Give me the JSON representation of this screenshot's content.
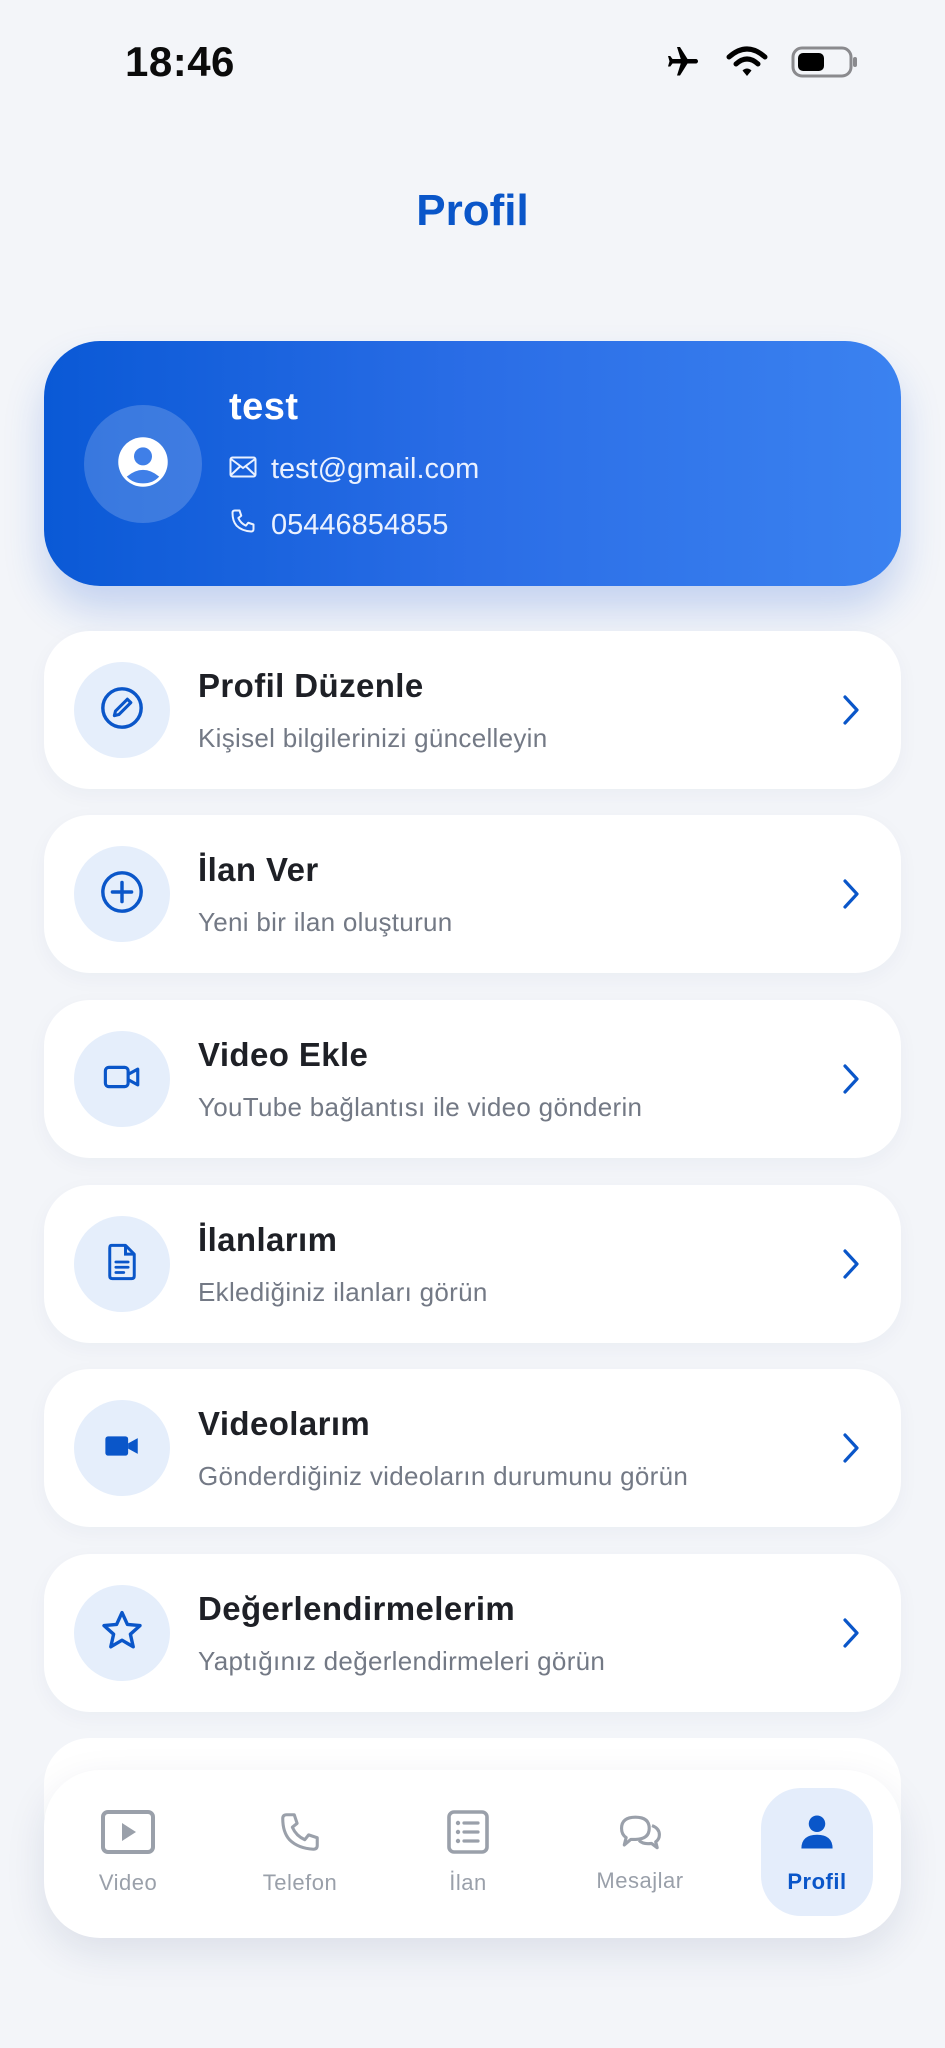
{
  "status_bar": {
    "time": "18:46"
  },
  "header": {
    "title": "Profil"
  },
  "profile": {
    "name": "test",
    "email": "test@gmail.com",
    "phone": "05446854855"
  },
  "menu": [
    {
      "title": "Profil Düzenle",
      "subtitle": "Kişisel bilgilerinizi güncelleyin",
      "icon": "edit-pencil-icon"
    },
    {
      "title": "İlan Ver",
      "subtitle": "Yeni bir ilan oluşturun",
      "icon": "plus-circle-icon"
    },
    {
      "title": "Video Ekle",
      "subtitle": "YouTube bağlantısı ile video gönderin",
      "icon": "video-camera-icon"
    },
    {
      "title": "İlanlarım",
      "subtitle": "Eklediğiniz ilanları görün",
      "icon": "document-icon"
    },
    {
      "title": "Videolarım",
      "subtitle": "Gönderdiğiniz videoların durumunu görün",
      "icon": "video-filled-icon"
    },
    {
      "title": "Değerlendirmelerim",
      "subtitle": "Yaptığınız değerlendirmeleri görün",
      "icon": "star-icon"
    }
  ],
  "bottom_nav": [
    {
      "label": "Video",
      "icon": "play-icon"
    },
    {
      "label": "Telefon",
      "icon": "phone-icon"
    },
    {
      "label": "İlan",
      "icon": "list-icon"
    },
    {
      "label": "Mesajlar",
      "icon": "chat-icon"
    },
    {
      "label": "Profil",
      "icon": "person-icon",
      "active": true
    }
  ],
  "colors": {
    "accent": "#0a56c9",
    "card_gradient_start": "#0a59d6",
    "card_gradient_end": "#3b82f0",
    "icon_bg": "#e5eefb",
    "background": "#f3f5f9"
  }
}
